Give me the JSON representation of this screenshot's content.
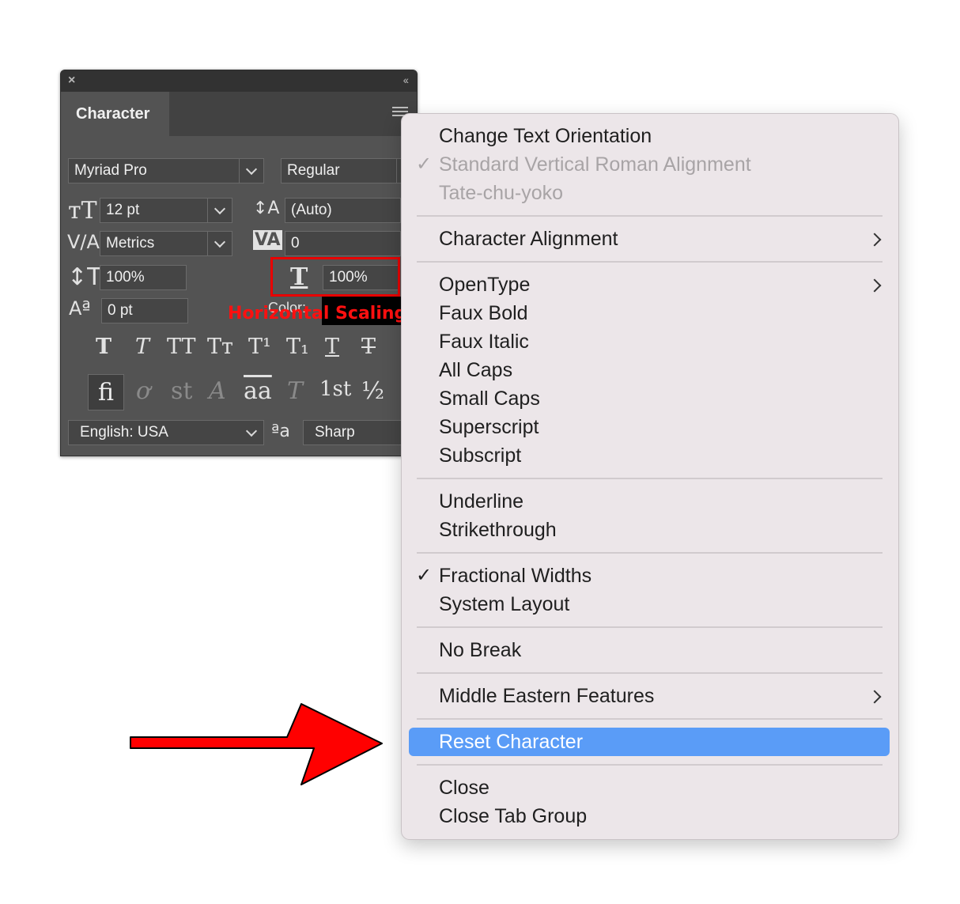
{
  "panel": {
    "title": "Character",
    "font_family": "Myriad Pro",
    "font_style": "Regular",
    "font_size": "12 pt",
    "leading": "(Auto)",
    "kerning": "Metrics",
    "tracking": "0",
    "vertical_scale": "100%",
    "horizontal_scale": "100%",
    "baseline_shift": "0 pt",
    "color_label": "Color:",
    "color_value": "#000000",
    "language": "English: USA",
    "antialias": "Sharp",
    "icons": {
      "close": "×",
      "collapse": "‹‹",
      "font_size_icon": "ᴛT",
      "leading_icon": "A/A",
      "kerning_icon": "V/A",
      "tracking_icon": "VA",
      "vscale_icon": "↕T",
      "hscale_icon": "T",
      "baseline_icon": "Aª",
      "aa_icon": "ªa"
    },
    "style_buttons": [
      "T",
      "T",
      "TT",
      "Tт",
      "T¹",
      "T₁",
      "T",
      "T"
    ],
    "opentype_buttons": [
      "fi",
      "ơ",
      "st",
      "A",
      "aa",
      "T",
      "1st",
      "½"
    ]
  },
  "annotation": {
    "label": "Horizontal Scaling"
  },
  "menu": {
    "items": [
      {
        "label": "Change Text Orientation"
      },
      {
        "label": "Standard Vertical Roman Alignment",
        "disabled": true,
        "checked": true
      },
      {
        "label": "Tate-chu-yoko",
        "disabled": true
      },
      {
        "label": "Character Alignment",
        "submenu": true
      },
      {
        "label": "OpenType",
        "submenu": true
      },
      {
        "label": "Faux Bold"
      },
      {
        "label": "Faux Italic"
      },
      {
        "label": "All Caps"
      },
      {
        "label": "Small Caps"
      },
      {
        "label": "Superscript"
      },
      {
        "label": "Subscript"
      },
      {
        "label": "Underline"
      },
      {
        "label": "Strikethrough"
      },
      {
        "label": "Fractional Widths",
        "checked": true
      },
      {
        "label": "System Layout"
      },
      {
        "label": "No Break"
      },
      {
        "label": "Middle Eastern Features",
        "submenu": true
      },
      {
        "label": "Reset Character",
        "selected": true
      },
      {
        "label": "Close"
      },
      {
        "label": "Close Tab Group"
      }
    ],
    "check_glyph": "✓"
  },
  "colors": {
    "panel_bg": "#535353",
    "menu_bg": "#ece6e9",
    "selection": "#5a9cf7",
    "annotation": "#e80000"
  }
}
